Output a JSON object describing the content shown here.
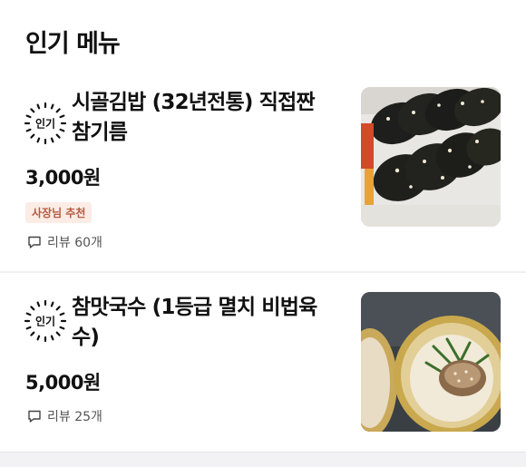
{
  "section": {
    "title": "인기 메뉴"
  },
  "items": [
    {
      "badge": "인기",
      "name": "시골김밥 (32년전통) 직접짠 참기름",
      "price": "3,000원",
      "tag": "사장님 추천",
      "review_label": "리뷰 60개",
      "review_icon": "comment-icon",
      "thumb_desc_icon": "gimbap-photo"
    },
    {
      "badge": "인기",
      "name": "참맛국수 (1등급 멸치 비법육수)",
      "price": "5,000원",
      "review_label": "리뷰 25개",
      "review_icon": "comment-icon",
      "thumb_desc_icon": "noodle-photo"
    }
  ],
  "colors": {
    "tag_bg": "#fbece6",
    "tag_text": "#b65a3e"
  }
}
